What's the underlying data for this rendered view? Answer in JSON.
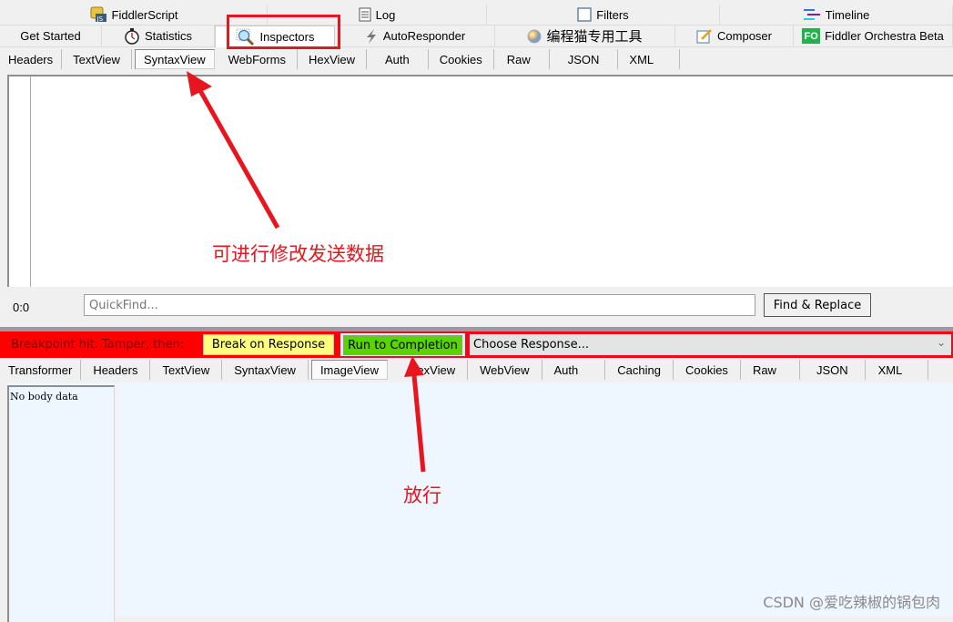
{
  "top_tabs_row1": [
    {
      "label": "FiddlerScript",
      "icon": "script-js-icon"
    },
    {
      "label": "Log",
      "icon": "log-icon"
    },
    {
      "label": "Filters",
      "icon": "checkbox-icon"
    },
    {
      "label": "Timeline",
      "icon": "timeline-icon"
    }
  ],
  "top_tabs_row2": [
    {
      "label": "Get Started",
      "icon": ""
    },
    {
      "label": "Statistics",
      "icon": "stopwatch-icon"
    },
    {
      "label": "Inspectors",
      "icon": "magnifier-icon",
      "active": true
    },
    {
      "label": "AutoResponder",
      "icon": "lightning-icon"
    },
    {
      "label": "编程猫专用工具",
      "icon": "color-wheel-icon"
    },
    {
      "label": "Composer",
      "icon": "composer-icon"
    },
    {
      "label": "Fiddler Orchestra Beta",
      "icon": "fo-icon",
      "icon_text": "FO"
    }
  ],
  "request_tabs": [
    "Headers",
    "TextView",
    "SyntaxView",
    "WebForms",
    "HexView",
    "Auth",
    "Cookies",
    "Raw",
    "JSON",
    "XML"
  ],
  "request_active_tab": "SyntaxView",
  "findbar": {
    "position": "0:0",
    "quickfind_placeholder": "QuickFind...",
    "find_replace_label": "Find & Replace"
  },
  "breakpoint": {
    "message": "Breakpoint hit. Tamper, then:",
    "break_on_response": "Break on Response",
    "run_to_completion": "Run to Completion",
    "choose_response": "Choose Response..."
  },
  "response_tabs": [
    "Transformer",
    "Headers",
    "TextView",
    "SyntaxView",
    "ImageView",
    "HexView",
    "WebView",
    "Auth",
    "Caching",
    "Cookies",
    "Raw",
    "JSON",
    "XML"
  ],
  "response_active_tab": "ImageView",
  "response_body_text": "No body data",
  "annotations": {
    "modify_note": "可进行修改发送数据",
    "release_note": "放行"
  },
  "watermark": "CSDN @爱吃辣椒的锅包肉",
  "colors": {
    "annotation_red": "#e8141e",
    "breakpoint_bar": "#ff0000",
    "break_button": "#ffff80",
    "run_button": "#59d400",
    "fo_badge": "#22b14c"
  }
}
